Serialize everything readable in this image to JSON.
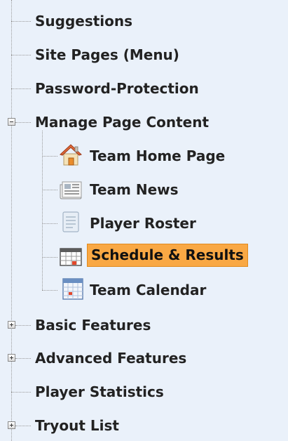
{
  "tree": {
    "items": [
      {
        "label": "Suggestions"
      },
      {
        "label": "Site Pages (Menu)"
      },
      {
        "label": "Password-Protection"
      },
      {
        "label": "Manage Page Content"
      },
      {
        "label": "Team Home Page"
      },
      {
        "label": "Team News"
      },
      {
        "label": "Player Roster"
      },
      {
        "label": "Schedule & Results"
      },
      {
        "label": "Team Calendar"
      },
      {
        "label": "Basic Features"
      },
      {
        "label": "Advanced Features"
      },
      {
        "label": "Player Statistics"
      },
      {
        "label": "Tryout List"
      }
    ],
    "selected_item": "Schedule & Results",
    "selected_color": "#f9a844",
    "icons": {
      "home": "house-icon",
      "news": "newspaper-icon",
      "roster": "document-icon",
      "schedule": "schedule-table-icon",
      "calendar": "calendar-icon",
      "expand": "expand-plus-icon",
      "collapse": "collapse-minus-icon"
    }
  }
}
